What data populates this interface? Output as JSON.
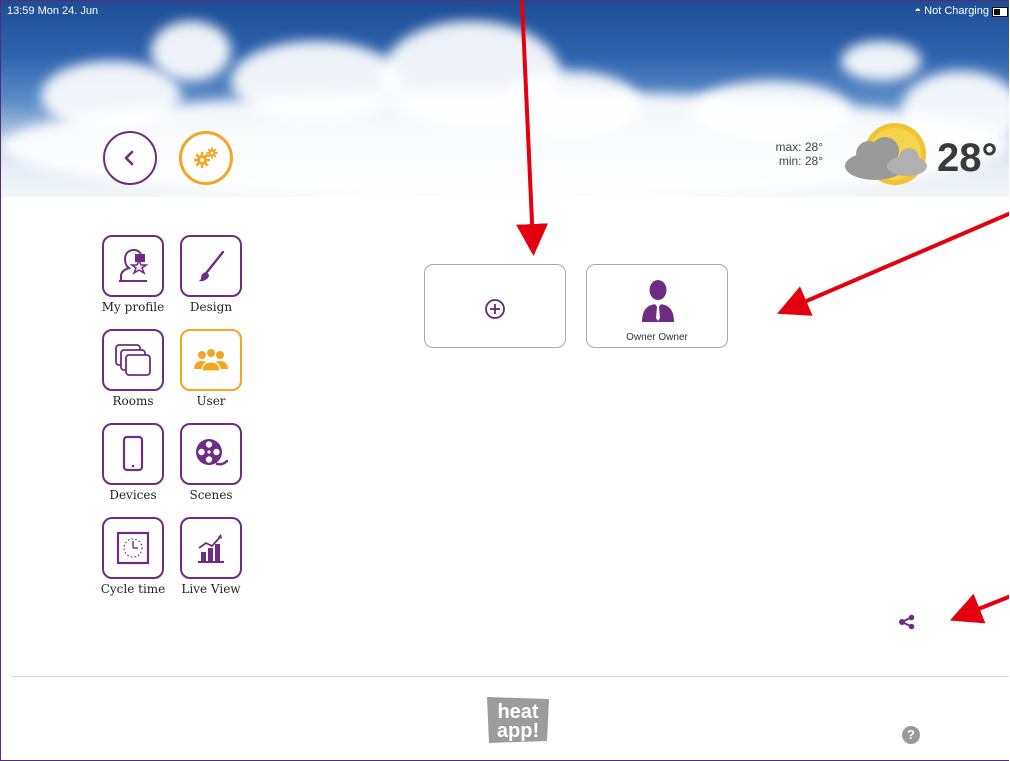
{
  "status_bar": {
    "time_date": "13:59  Mon 24. Jun",
    "charging": "Not Charging"
  },
  "header": {
    "back_icon": "chevron-left-icon",
    "settings_icon": "gears-icon"
  },
  "weather": {
    "max": "max: 28°",
    "min": "min: 28°",
    "temperature": "28°",
    "icon": "partly-cloudy-icon"
  },
  "menu": {
    "items": [
      {
        "label": "My profile",
        "icon": "profile-star-icon"
      },
      {
        "label": "Design",
        "icon": "brush-icon"
      },
      {
        "label": "Rooms",
        "icon": "rooms-icon"
      },
      {
        "label": "User",
        "icon": "users-icon",
        "active": true
      },
      {
        "label": "Devices",
        "icon": "tablet-icon"
      },
      {
        "label": "Scenes",
        "icon": "film-reel-icon"
      },
      {
        "label": "Cycle time",
        "icon": "clock-icon"
      },
      {
        "label": "Live View",
        "icon": "chart-icon"
      }
    ]
  },
  "main": {
    "add_user_icon": "plus-circle-icon",
    "user_tile": {
      "name": "Owner Owner",
      "icon": "user-avatar-icon"
    }
  },
  "footer": {
    "logo_line1": "heat",
    "logo_line2": "app!",
    "help_label": "?",
    "share_icon": "share-icon"
  },
  "colors": {
    "accent_purple": "#6e2c82",
    "accent_orange": "#f5a524",
    "annotation_red": "#e3000f"
  }
}
